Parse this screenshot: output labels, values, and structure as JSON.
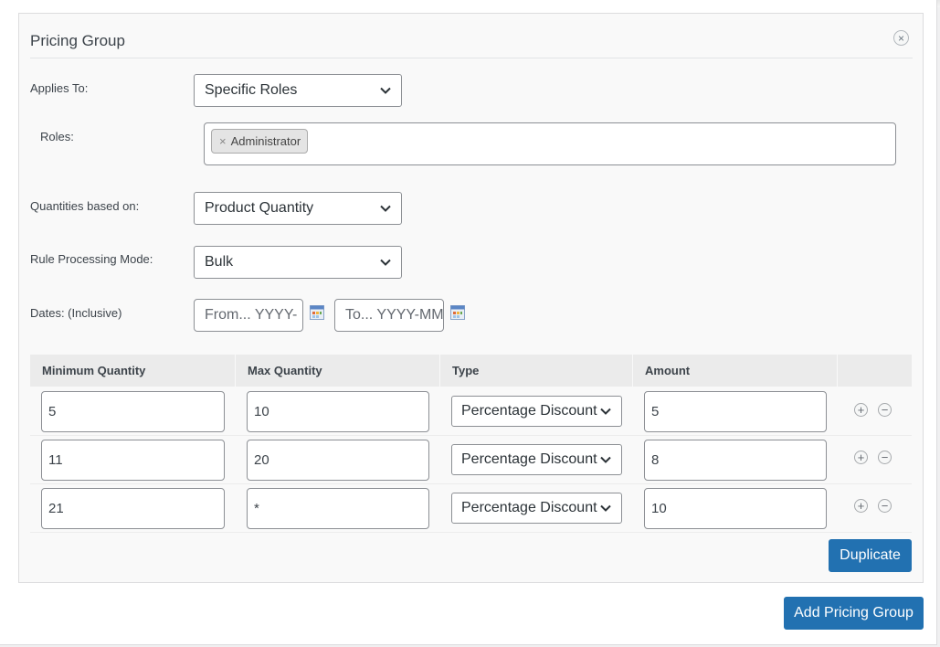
{
  "panel": {
    "title": "Pricing Group",
    "close_glyph": "×"
  },
  "applies_to": {
    "label": "Applies To:",
    "value": "Specific Roles"
  },
  "roles": {
    "label": "Roles:",
    "tags": [
      {
        "remove_glyph": "×",
        "label": "Administrator"
      }
    ]
  },
  "quantities": {
    "label": "Quantities based on:",
    "value": "Product Quantity"
  },
  "processing": {
    "label": "Rule Processing Mode:",
    "value": "Bulk"
  },
  "dates": {
    "label": "Dates: (Inclusive)",
    "from_placeholder": "From... YYYY-",
    "to_placeholder": "To... YYYY-MM"
  },
  "table": {
    "headers": [
      "Minimum Quantity",
      "Max Quantity",
      "Type",
      "Amount"
    ],
    "rows": [
      {
        "min": "5",
        "max": "10",
        "type": "Percentage Discount",
        "amount": "5"
      },
      {
        "min": "11",
        "max": "20",
        "type": "Percentage Discount",
        "amount": "8"
      },
      {
        "min": "21",
        "max": "*",
        "type": "Percentage Discount",
        "amount": "10"
      }
    ],
    "add_glyph": "+",
    "remove_glyph": "−"
  },
  "buttons": {
    "duplicate": "Duplicate",
    "add_group": "Add Pricing Group"
  },
  "icons": {
    "close": "close-circle-icon",
    "chevron": "chevron-down-icon",
    "calendar": "calendar-icon",
    "add": "plus-circle-icon",
    "remove": "minus-circle-icon"
  },
  "colors": {
    "primary": "#2271b1",
    "panel_bg": "#f9f9f9",
    "header_bg": "#ebebeb"
  }
}
